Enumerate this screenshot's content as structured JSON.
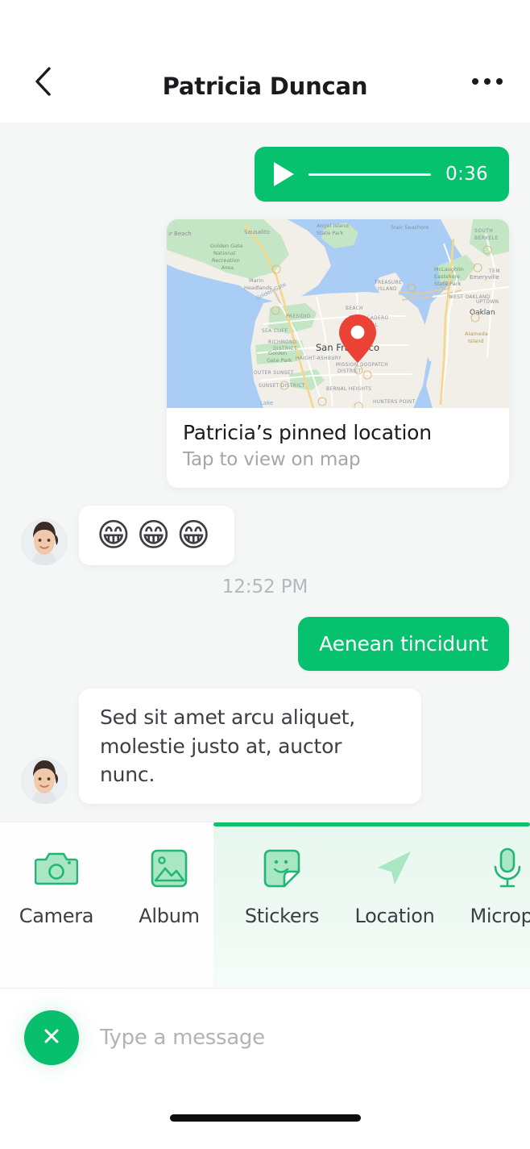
{
  "header": {
    "title": "Patricia Duncan",
    "back_icon": "chevron-left-icon",
    "more_icon": "ellipsis-icon"
  },
  "chat": {
    "messages": [
      {
        "id": "voice",
        "type": "voice",
        "direction": "out",
        "duration": "0:36",
        "play_icon": "play-icon"
      },
      {
        "id": "location",
        "type": "location-card",
        "direction": "out",
        "title": "Patricia’s pinned location",
        "subtitle": "Tap to view on map",
        "map_label": "San Francisco",
        "pin_icon": "map-pin-icon",
        "map_places": [
          "ir Beach",
          "Sausalito",
          "Angel Island State Park",
          "Stair Seashore",
          "SOUTH BERKELE",
          "Golden Gate National Recreation Area",
          "Marin Headlands",
          "Golden Gate",
          "TREASURE ISLAND",
          "McLaughlin Eastshore State Park",
          "Emeryville",
          "TEM",
          "WEST OAKLAND",
          "UPTOWN",
          "Oaklan",
          "PRESIDIO",
          "BEACH",
          "EMBARCADERO",
          "FINANCIAL DISTRICT",
          "SEA CLIFF",
          "RICHMOND DISTRICT",
          "Alameda Island",
          "Golden Gate Park",
          "HAIGHT-ASHBURY",
          "MISSION DISTRICT",
          "DOGPATCH",
          "OUTER SUNSET",
          "SUNSET DISTRICT",
          "BERNAL HEIGHTS",
          "HUNTERS POINT",
          "Lake"
        ]
      },
      {
        "id": "emoji",
        "type": "emoji",
        "direction": "in",
        "text": "😁😁😁",
        "avatar": "contact-avatar"
      },
      {
        "id": "timestamp",
        "type": "timestamp",
        "text": "12:52 PM"
      },
      {
        "id": "msg-out",
        "type": "text",
        "direction": "out",
        "text": "Aenean tincidunt"
      },
      {
        "id": "msg-in",
        "type": "text",
        "direction": "in",
        "text": "Sed sit amet arcu aliquet, molestie justo at, auctor nunc.",
        "avatar": "contact-avatar"
      }
    ]
  },
  "tray": {
    "items": [
      {
        "label": "Camera",
        "icon": "camera-icon"
      },
      {
        "label": "Album",
        "icon": "photo-album-icon"
      },
      {
        "label": "Stickers",
        "icon": "sticker-icon"
      },
      {
        "label": "Location",
        "icon": "navigation-arrow-icon"
      },
      {
        "label": "Microph",
        "icon": "microphone-icon"
      }
    ]
  },
  "input_bar": {
    "close_icon": "close-icon",
    "placeholder": "Type a message",
    "value": ""
  },
  "home_indicator": {
    "name": "home-indicator"
  },
  "colors": {
    "accent_green": "#06c16e",
    "fab_green": "#07bf6c",
    "tray_icon_green": "#22b573",
    "tray_icon_fill": "#a8e6c4",
    "chat_bg": "#f5f6f6",
    "bubble_in_bg": "#ffffff",
    "text_primary": "#1b1b1f",
    "text_secondary": "#a3a6ab",
    "timestamp_gray": "#b5b8bd",
    "map_water": "#aacdf5",
    "map_land": "#f2efe9",
    "map_park": "#c5e6c4",
    "map_pin_red": "#ea4335"
  }
}
